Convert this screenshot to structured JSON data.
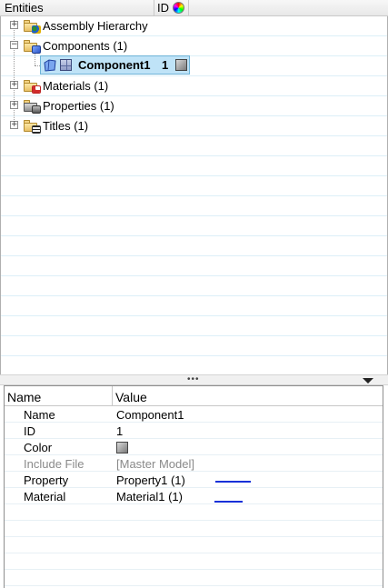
{
  "browser": {
    "columns": {
      "entities": "Entities",
      "id": "ID"
    },
    "tree": [
      {
        "label": "Assembly Hierarchy",
        "icon": "assembly-folder-icon",
        "expanded": false
      },
      {
        "label": "Components (1)",
        "icon": "components-folder-icon",
        "expanded": true,
        "children": [
          {
            "label": "Component1",
            "id": "1",
            "color": "#9a9a9a",
            "selected": true
          }
        ]
      },
      {
        "label": "Materials (1)",
        "icon": "materials-folder-icon",
        "expanded": false
      },
      {
        "label": "Properties (1)",
        "icon": "properties-folder-icon",
        "expanded": false
      },
      {
        "label": "Titles (1)",
        "icon": "titles-folder-icon",
        "expanded": false
      }
    ],
    "expand_glyph": "+",
    "collapse_glyph": "−"
  },
  "splitter": {
    "grip": "•••"
  },
  "properties": {
    "columns": {
      "name": "Name",
      "value": "Value"
    },
    "rows": [
      {
        "name": "Name",
        "value": "Component1"
      },
      {
        "name": "ID",
        "value": "1"
      },
      {
        "name": "Color",
        "value": "",
        "swatch": "#9a9a9a"
      },
      {
        "name": "Include File",
        "value": "[Master Model]",
        "muted": true
      },
      {
        "name": "Property",
        "value": "Property1 (1)"
      },
      {
        "name": "Material",
        "value": "Material1 (1)"
      }
    ]
  },
  "colors": {
    "selection_bg": "#bfe3f7",
    "annotation_blue": "#1530d8"
  }
}
